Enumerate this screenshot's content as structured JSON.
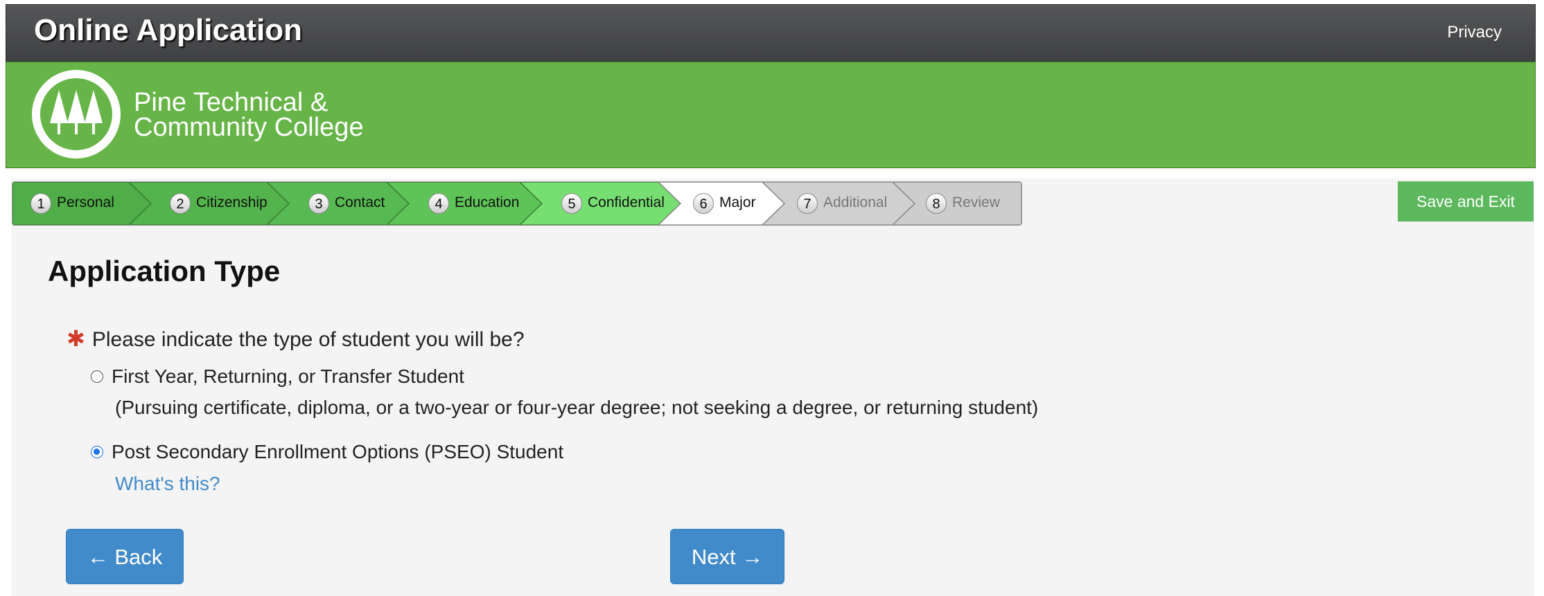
{
  "header": {
    "title": "Online Application",
    "privacy_link": "Privacy"
  },
  "banner": {
    "college_name_line1": "Pine Technical &",
    "college_name_line2": "Community College"
  },
  "steps": [
    {
      "num": "1",
      "label": "Personal",
      "state": "complete"
    },
    {
      "num": "2",
      "label": "Citizenship",
      "state": "complete"
    },
    {
      "num": "3",
      "label": "Contact",
      "state": "complete"
    },
    {
      "num": "4",
      "label": "Education",
      "state": "complete"
    },
    {
      "num": "5",
      "label": "Confidential",
      "state": "complete"
    },
    {
      "num": "6",
      "label": "Major",
      "state": "current"
    },
    {
      "num": "7",
      "label": "Additional",
      "state": "future"
    },
    {
      "num": "8",
      "label": "Review",
      "state": "future"
    }
  ],
  "save_exit_label": "Save and Exit",
  "page_title": "Application Type",
  "question": {
    "required_marker": "✱",
    "text": "Please indicate the type of student you will be?"
  },
  "options": [
    {
      "label": "First Year, Returning, or Transfer Student",
      "description": "(Pursuing certificate, diploma, or a two-year or four-year degree; not seeking a degree, or returning student)",
      "checked": false
    },
    {
      "label": "Post Secondary Enrollment Options (PSEO) Student",
      "link": "What's this?",
      "checked": true
    }
  ],
  "buttons": {
    "back": "← Back",
    "next": "Next →"
  },
  "colors": {
    "brand_green": "#67b548",
    "button_blue": "#428bca",
    "save_green": "#5cb85c",
    "required_red": "#d23b2a"
  }
}
